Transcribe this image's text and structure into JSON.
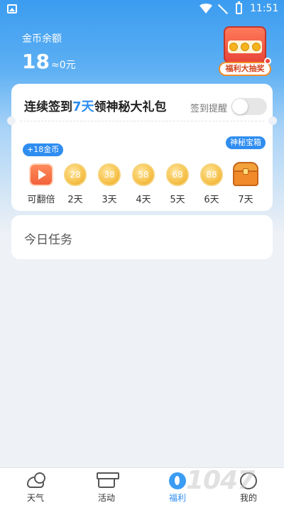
{
  "status_bar": {
    "time": "11:51",
    "icons": [
      "image-icon",
      "wifi-icon",
      "signal-icon",
      "battery-icon"
    ]
  },
  "header": {
    "balance_label": "金币余额",
    "coins": "18",
    "yuan": "≈0元"
  },
  "lottery": {
    "label": "福利大抽奖",
    "icon": "slot-machine-icon"
  },
  "signin": {
    "title_prefix": "连续签到",
    "title_highlight": "7天",
    "title_suffix": "领神秘大礼包",
    "remind_label": "签到提醒",
    "remind_enabled": false,
    "bonus_bubble": "+18金币",
    "mystery_bubble": "神秘宝箱",
    "days": [
      {
        "label": "可翻倍",
        "type": "video",
        "value": ""
      },
      {
        "label": "2天",
        "type": "coin",
        "value": "28"
      },
      {
        "label": "3天",
        "type": "coin",
        "value": "38"
      },
      {
        "label": "4天",
        "type": "coin",
        "value": "58"
      },
      {
        "label": "5天",
        "type": "coin",
        "value": "68"
      },
      {
        "label": "6天",
        "type": "coin",
        "value": "88"
      },
      {
        "label": "7天",
        "type": "chest",
        "value": ""
      }
    ]
  },
  "tasks": {
    "title": "今日任务"
  },
  "bottom_nav": {
    "items": [
      {
        "label": "天气",
        "icon": "weather-icon",
        "active": false
      },
      {
        "label": "活动",
        "icon": "gift-icon",
        "active": false
      },
      {
        "label": "福利",
        "icon": "welfare-icon",
        "active": true
      },
      {
        "label": "我的",
        "icon": "profile-icon",
        "active": false
      }
    ]
  },
  "watermark": "1047",
  "colors": {
    "accent": "#2f8df0",
    "header_blue": "#3b9cf0",
    "coin_gold": "#f6c14a",
    "background": "#eef1f6"
  }
}
